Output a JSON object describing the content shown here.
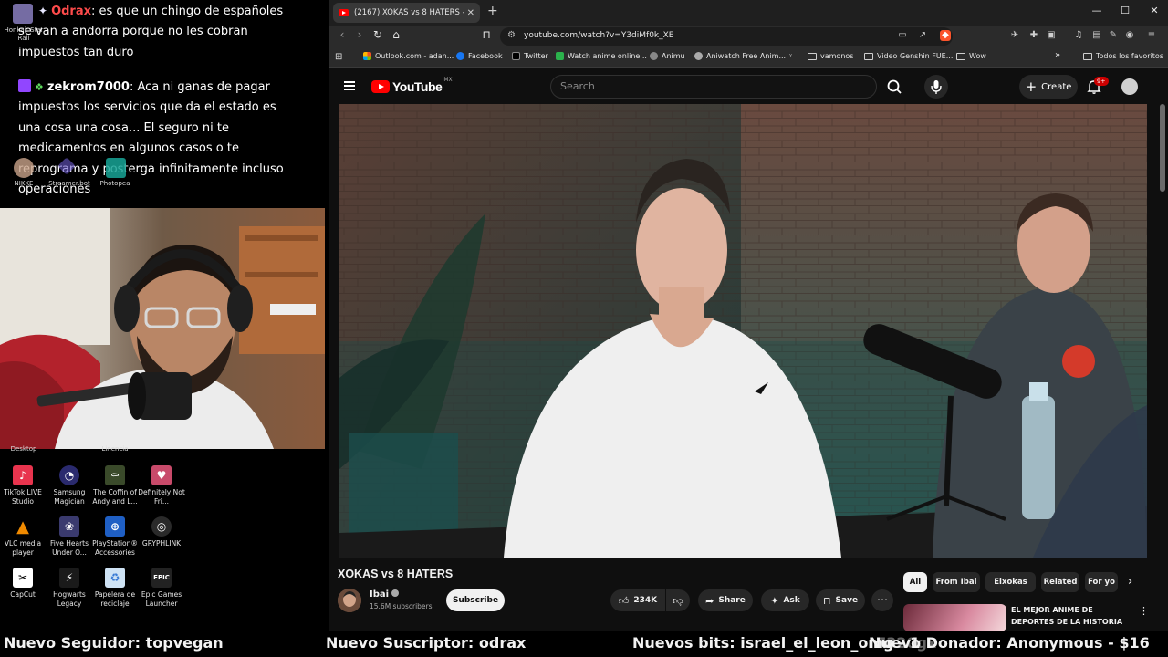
{
  "chat": {
    "messages": [
      {
        "user": "Odrax",
        "user_color": "#ff4b4b",
        "text": ": es que un chingo de españoles se van a andorra porque no les cobran impuestos tan duro"
      },
      {
        "user": "zekrom7000",
        "user_color": "#ffffff",
        "text": ": Aca ni ganas de pagar impuestos los servicios que da el estado es una cosa una cosa... El seguro ni te medicamentos en algunos casos o te reprograma y posterga infinitamente incluso operaciones"
      }
    ],
    "ghost_labels": {
      "honkai": "Honkai: Star Rail",
      "nikke": "NIKKE",
      "streamerbot": "Streamer.bot",
      "photopea": "Photopea",
      "desktop": "Desktop",
      "lineacia": "Linencia"
    }
  },
  "desktop": {
    "icons": [
      {
        "label": "TikTok LIVE Studio",
        "icon": "tiktok-icon",
        "color": "#e8344e"
      },
      {
        "label": "Samsung Magician",
        "icon": "samsung-icon",
        "color": "#2a2a6e"
      },
      {
        "label": "The Coffin of Andy and L...",
        "icon": "coffin-icon",
        "color": "#3a4a2a"
      },
      {
        "label": "Definitely Not Fri...",
        "icon": "game-icon",
        "color": "#c84a6a"
      },
      {
        "label": "VLC media player",
        "icon": "vlc-icon",
        "color": "#f08a00"
      },
      {
        "label": "Five Hearts Under O...",
        "icon": "hearts-icon",
        "color": "#3a3a6e"
      },
      {
        "label": "PlayStation® Accessories",
        "icon": "playstation-icon",
        "color": "#1f5fc4"
      },
      {
        "label": "GRYPHLINK",
        "icon": "gryphlink-icon",
        "color": "#2a2a2a"
      },
      {
        "label": "CapCut",
        "icon": "capcut-icon",
        "color": "#ffffff"
      },
      {
        "label": "Hogwarts Legacy",
        "icon": "hogwarts-icon",
        "color": "#1a1a1a"
      },
      {
        "label": "Papelera de reciclaje",
        "icon": "recycle-bin-icon",
        "color": "#cfe3f5"
      },
      {
        "label": "Epic Games Launcher",
        "icon": "epic-icon",
        "color": "#222222"
      }
    ]
  },
  "browser": {
    "tab_title": "(2167) XOKAS vs 8 HATERS - Y",
    "new_tab": "+",
    "window": {
      "minimize": "—",
      "maximize": "☐",
      "close": "✕"
    },
    "url": "youtube.com/watch?v=Y3diMf0k_XE",
    "bookmarks": [
      {
        "label": "Outlook.com - adan...",
        "icon": "microsoft-icon",
        "color": "#f25022"
      },
      {
        "label": "Facebook",
        "icon": "facebook-icon",
        "color": "#1877f2"
      },
      {
        "label": "Twitter",
        "icon": "x-icon",
        "color": "#000000"
      },
      {
        "label": "Watch anime online...",
        "icon": "anime-icon",
        "color": "#2bb24c"
      },
      {
        "label": "Animu",
        "icon": "animu-icon",
        "color": "#888888"
      },
      {
        "label": "Aniwatch Free Anim...",
        "icon": "aniwatch-icon",
        "color": "#aaaaaa"
      },
      {
        "label": "vamonos",
        "icon": "folder-icon",
        "color": ""
      },
      {
        "label": "Video Genshin FUE...",
        "icon": "folder-icon",
        "color": ""
      },
      {
        "label": "Wow",
        "icon": "folder-icon",
        "color": ""
      }
    ],
    "bookmarks_overflow": "»",
    "all_favorites": "Todos los favoritos"
  },
  "youtube": {
    "logo_word": "YouTube",
    "country": "MX",
    "search_placeholder": "Search",
    "create_label": "Create",
    "notifications": "9+",
    "video": {
      "title": "XOKAS vs 8 HATERS",
      "channel": "Ibai",
      "subscribers": "15.6M subscribers",
      "subscribe_label": "Subscribe",
      "likes": "234K",
      "share_label": "Share",
      "ask_label": "Ask",
      "save_label": "Save"
    },
    "chips": [
      "All",
      "From Ibai",
      "Elxokas",
      "Related",
      "For yo"
    ],
    "recommended": {
      "title": "EL MEJOR ANIME DE DEPORTES DE LA HISTORIA"
    }
  },
  "alerts": {
    "follower": "Nuevo Seguidor: topvegan",
    "subscriber": "Nuevo Suscriptor: odrax",
    "bits": "Nuevos bits: israel_el_leon_omg - 1",
    "donation": "Nuevo Donador: Anonymous - $16",
    "ghost": "7320gx"
  },
  "colors": {
    "yt_red": "#ff0000",
    "chat_user_odrax": "#ff4b4b",
    "twitch_purple": "#9146ff"
  }
}
